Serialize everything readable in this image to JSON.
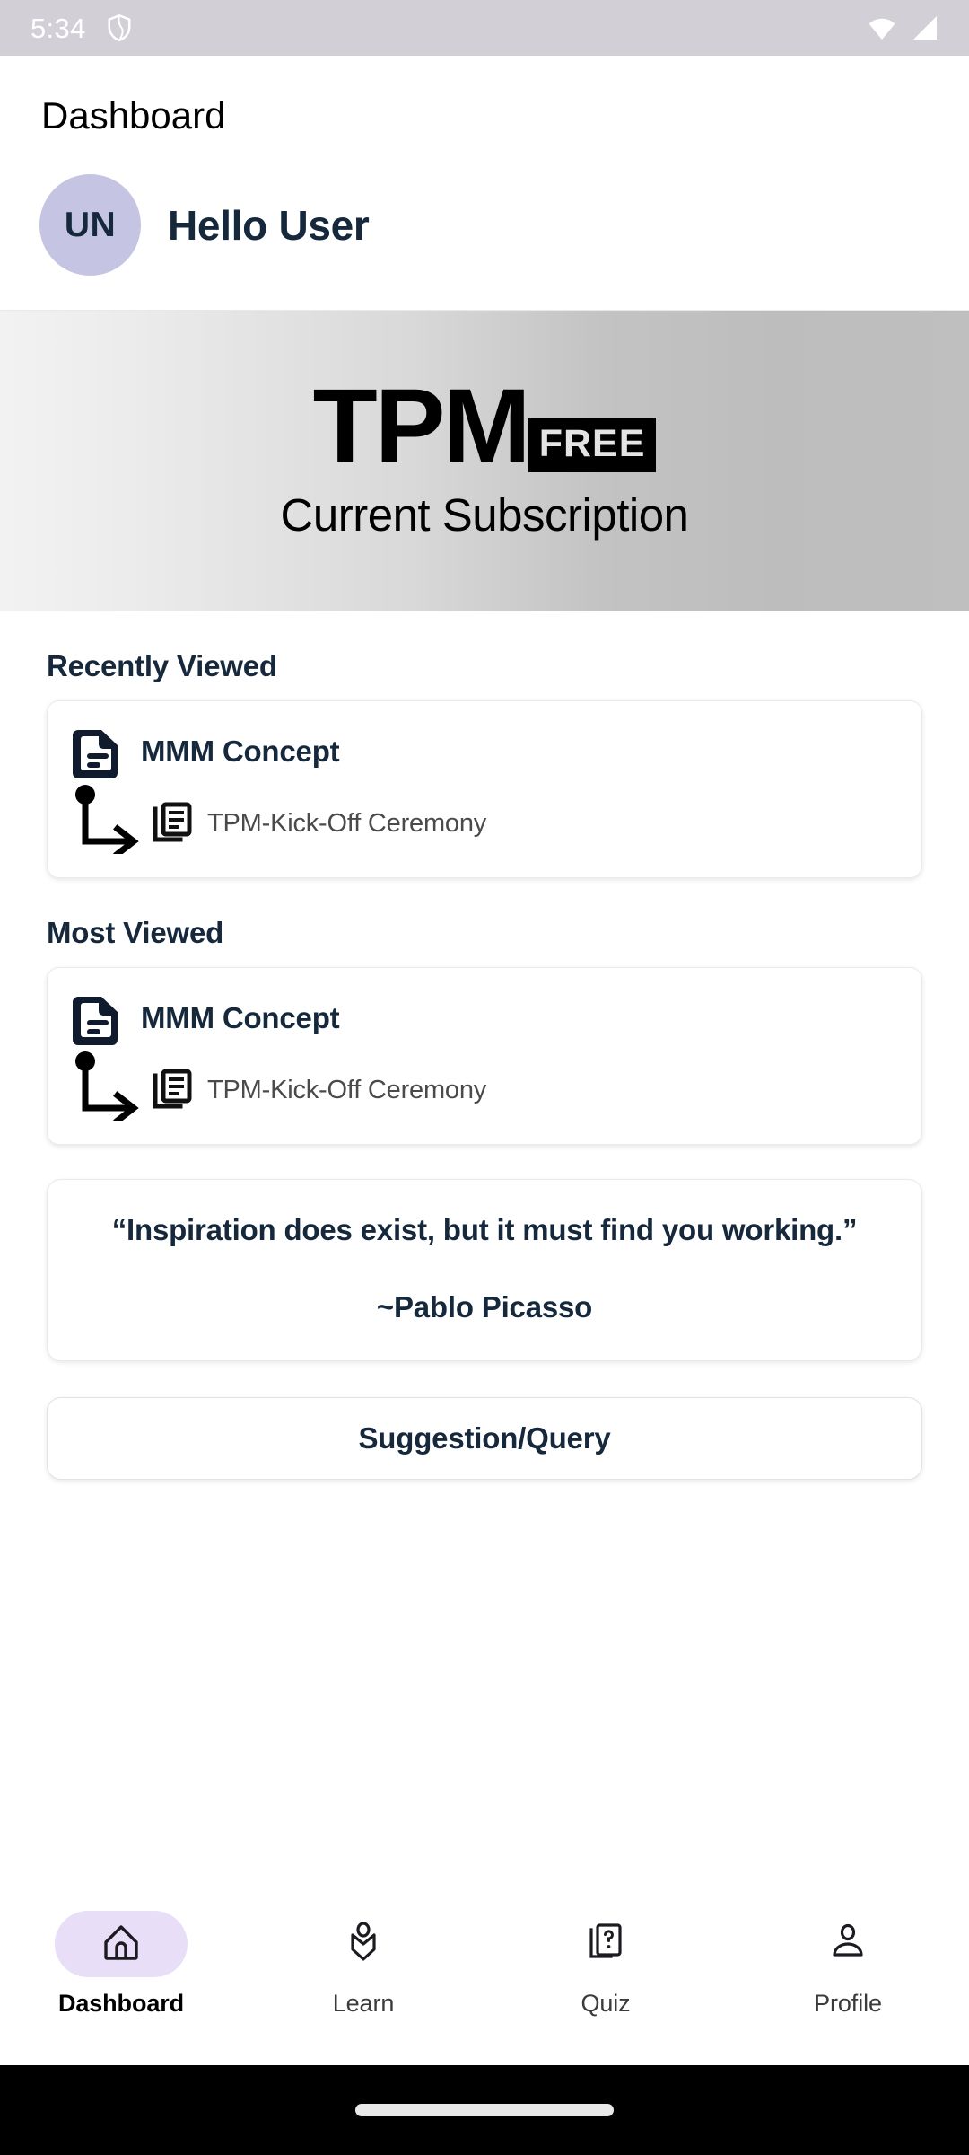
{
  "status_bar": {
    "time": "5:34",
    "icons": [
      "shield-icon",
      "wifi-icon",
      "cellular-signal-icon"
    ],
    "background_color": "#d2cfd6",
    "foreground_color": "#ffffff"
  },
  "header": {
    "page_title": "Dashboard",
    "avatar_initials": "UN",
    "greeting": "Hello User",
    "avatar_bg_color": "#c5c4e3",
    "avatar_text_color": "#16283c"
  },
  "banner": {
    "logo_text": "TPM",
    "badge_text": "FREE",
    "subtitle": "Current Subscription",
    "badge_bg_color": "#000000",
    "badge_text_color": "#e4e4e4"
  },
  "sections": [
    {
      "title": "Recently Viewed",
      "card": {
        "main_label": "MMM Concept",
        "main_icon": "document-icon",
        "sub_label": "TPM-Kick-Off Ceremony",
        "sub_icon": "article-list-icon"
      }
    },
    {
      "title": "Most Viewed",
      "card": {
        "main_label": "MMM Concept",
        "main_icon": "document-icon",
        "sub_label": "TPM-Kick-Off Ceremony",
        "sub_icon": "article-list-icon"
      }
    }
  ],
  "quote": {
    "text": "“Inspiration does exist, but it must find you working.”",
    "author": "~Pablo Picasso"
  },
  "suggestion_button": {
    "label": "Suggestion/Query"
  },
  "bottom_nav": {
    "active_index": 0,
    "active_pill_color": "#e8def8",
    "items": [
      {
        "label": "Dashboard",
        "icon": "home-icon"
      },
      {
        "label": "Learn",
        "icon": "book-bookmark-icon"
      },
      {
        "label": "Quiz",
        "icon": "quiz-card-question-icon"
      },
      {
        "label": "Profile",
        "icon": "person-icon"
      }
    ]
  }
}
